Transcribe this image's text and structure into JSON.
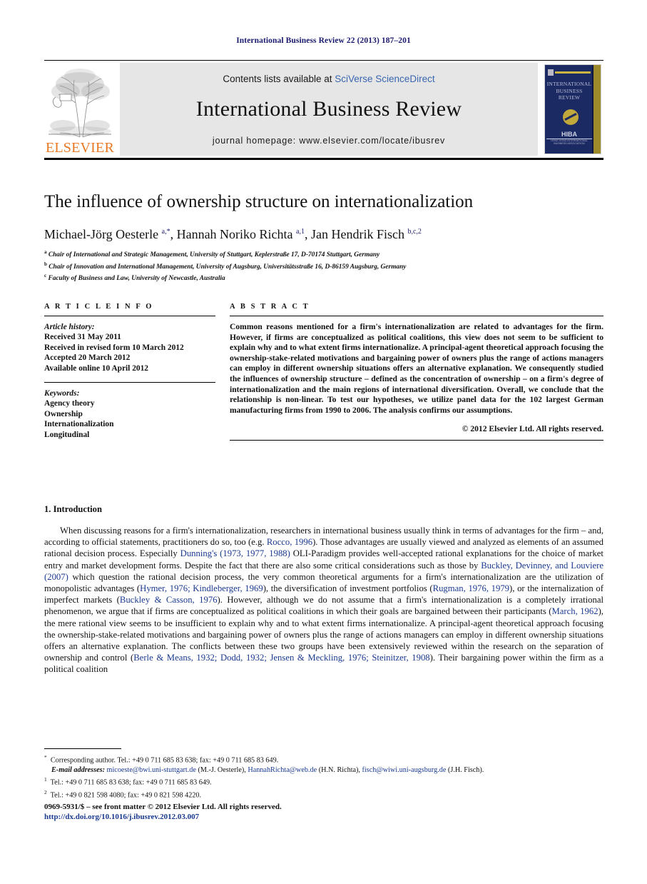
{
  "running_head": "International Business Review 22 (2013) 187–201",
  "masthead": {
    "publisher_name": "ELSEVIER",
    "contents_prefix": "Contents lists available at ",
    "contents_link": "SciVerse ScienceDirect",
    "journal_title": "International Business Review",
    "homepage": "journal homepage: www.elsevier.com/locate/ibusrev",
    "cover": {
      "title_line1": "INTERNATIONAL",
      "title_line2": "BUSINESS",
      "title_line3": "REVIEW",
      "society": "HIBA",
      "society_sub": "HONG KONG INTERNATIONAL BUSINESS ASSOCIATION"
    }
  },
  "article": {
    "title": "The influence of ownership structure on internationalization",
    "authors_html": "Michael-Jörg Oesterle <sup>a,*</sup>, Hannah Noriko Richta <sup>a,1</sup>, Jan Hendrik Fisch <sup>b,c,2</sup>",
    "affiliations": [
      {
        "marker": "a",
        "text": "Chair of International and Strategic Management, University of Stuttgart, Keplerstraße 17, D-70174 Stuttgart, Germany"
      },
      {
        "marker": "b",
        "text": "Chair of Innovation and International Management, University of Augsburg, Universitätsstraße 16, D-86159 Augsburg, Germany"
      },
      {
        "marker": "c",
        "text": "Faculty of Business and Law, University of Newcastle, Australia"
      }
    ]
  },
  "article_info": {
    "heading": "A R T I C L E   I N F O",
    "history_label": "Article history:",
    "history": [
      "Received 31 May 2011",
      "Received in revised form 10 March 2012",
      "Accepted 20 March 2012",
      "Available online 10 April 2012"
    ],
    "keywords_label": "Keywords:",
    "keywords": [
      "Agency theory",
      "Ownership",
      "Internationalization",
      "Longitudinal"
    ]
  },
  "abstract": {
    "heading": "A B S T R A C T",
    "text": "Common reasons mentioned for a firm's internationalization are related to advantages for the firm. However, if firms are conceptualized as political coalitions, this view does not seem to be sufficient to explain why and to what extent firms internationalize. A principal-agent theoretical approach focusing the ownership-stake-related motivations and bargaining power of owners plus the range of actions managers can employ in different ownership situations offers an alternative explanation. We consequently studied the influences of ownership structure – defined as the concentration of ownership – on a firm's degree of internationalization and the main regions of international diversification. Overall, we conclude that the relationship is non-linear. To test our hypotheses, we utilize panel data for the 102 largest German manufacturing firms from 1990 to 2006. The analysis confirms our assumptions.",
    "copyright": "© 2012 Elsevier Ltd. All rights reserved."
  },
  "body": {
    "section_number": "1.",
    "section_title": "Introduction",
    "paragraph_html": "When discussing reasons for a firm's internationalization, researchers in international business usually think in terms of advantages for the firm – and, according to official statements, practitioners do so, too (e.g. <span class=\"ref\">Rocco, 1996</span>). Those advantages are usually viewed and analyzed as elements of an assumed rational decision process. Especially <span class=\"ref\">Dunning's (1973, 1977, 1988)</span> OLI-Paradigm provides well-accepted rational explanations for the choice of market entry and market development forms. Despite the fact that there are also some critical considerations such as those by <span class=\"ref\">Buckley, Devinney, and Louviere (2007)</span> which question the rational decision process, the very common theoretical arguments for a firm's internationalization are the utilization of monopolistic advantages (<span class=\"ref\">Hymer, 1976; Kindleberger, 1969</span>), the diversification of investment portfolios (<span class=\"ref\">Rugman, 1976, 1979</span>), or the internalization of imperfect markets (<span class=\"ref\">Buckley &amp; Casson, 1976</span>). However, although we do not assume that a firm's internationalization is a completely irrational phenomenon, we argue that if firms are conceptualized as political coalitions in which their goals are bargained between their participants (<span class=\"ref\">March, 1962</span>), the mere rational view seems to be insufficient to explain why and to what extent firms internationalize. A principal-agent theoretical approach focusing the ownership-stake-related motivations and bargaining power of owners plus the range of actions managers can employ in different ownership situations offers an alternative explanation. The conflicts between these two groups have been extensively reviewed within the research on the separation of ownership and control (<span class=\"ref\">Berle &amp; Means, 1932; Dodd, 1932; Jensen &amp; Meckling, 1976; Steinitzer, 1908</span>). Their bargaining power within the firm as a political coalition"
  },
  "footnotes": {
    "corresponding_html": "<sup>*</sup>&nbsp; Corresponding author. Tel.: +49 0 711 685 83 638; fax: +49 0 711 685 83 649.",
    "emails_html": "<span class=\"it\">E-mail addresses:</span> <span class=\"mail\">micoeste@bwi.uni-stuttgart.de</span> (M.-J. Oesterle), <span class=\"mail\">HannahRichta@web.de</span> (H.N. Richta), <span class=\"mail\">fisch@wiwi.uni-augsburg.de</span> (J.H. Fisch).",
    "note1_html": "<sup>1</sup>&nbsp; Tel.: +49 0 711 685 83 638; fax: +49 0 711 685 83 649.",
    "note2_html": "<sup>2</sup>&nbsp; Tel.: +49 0 821 598 4080; fax: +49 0 821 598 4220."
  },
  "bottom": {
    "issn_line": "0969-5931/$ – see front matter © 2012 Elsevier Ltd. All rights reserved.",
    "doi": "http://dx.doi.org/10.1016/j.ibusrev.2012.03.007"
  },
  "colors": {
    "link_blue": "#1a3a8f",
    "sciencedirect_blue": "#3a66b0",
    "elsevier_orange": "#E87722",
    "cover_navy": "#1c2a63",
    "cover_gold": "#9d8a2a"
  }
}
